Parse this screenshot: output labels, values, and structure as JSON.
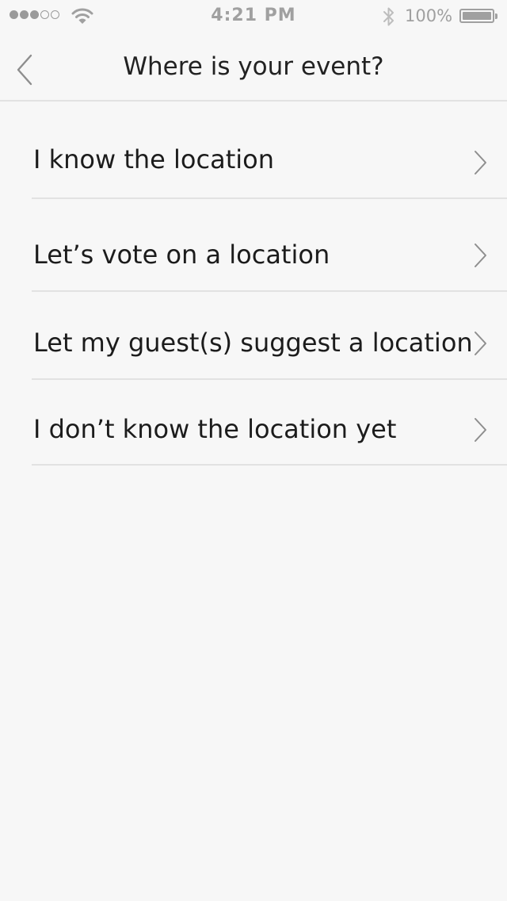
{
  "status_bar": {
    "time": "4:21 PM",
    "battery_percent": "100%",
    "signal_bars_filled": 3,
    "signal_bars_total": 5
  },
  "nav": {
    "back_icon": "chevron-left-icon",
    "title": "Where is your event?"
  },
  "options": [
    {
      "label": "I know the location",
      "icon": "chevron-right-icon"
    },
    {
      "label": "Let’s vote on a location",
      "icon": "chevron-right-icon"
    },
    {
      "label": "Let my guest(s) suggest a location",
      "icon": "chevron-right-icon"
    },
    {
      "label": "I don’t know the location yet",
      "icon": "chevron-right-icon"
    }
  ],
  "colors": {
    "background": "#f7f7f7",
    "text": "#1c1c1c",
    "status_gray": "#a0a0a0",
    "divider": "#e2e2e2",
    "chevron": "#8e8e8e"
  }
}
